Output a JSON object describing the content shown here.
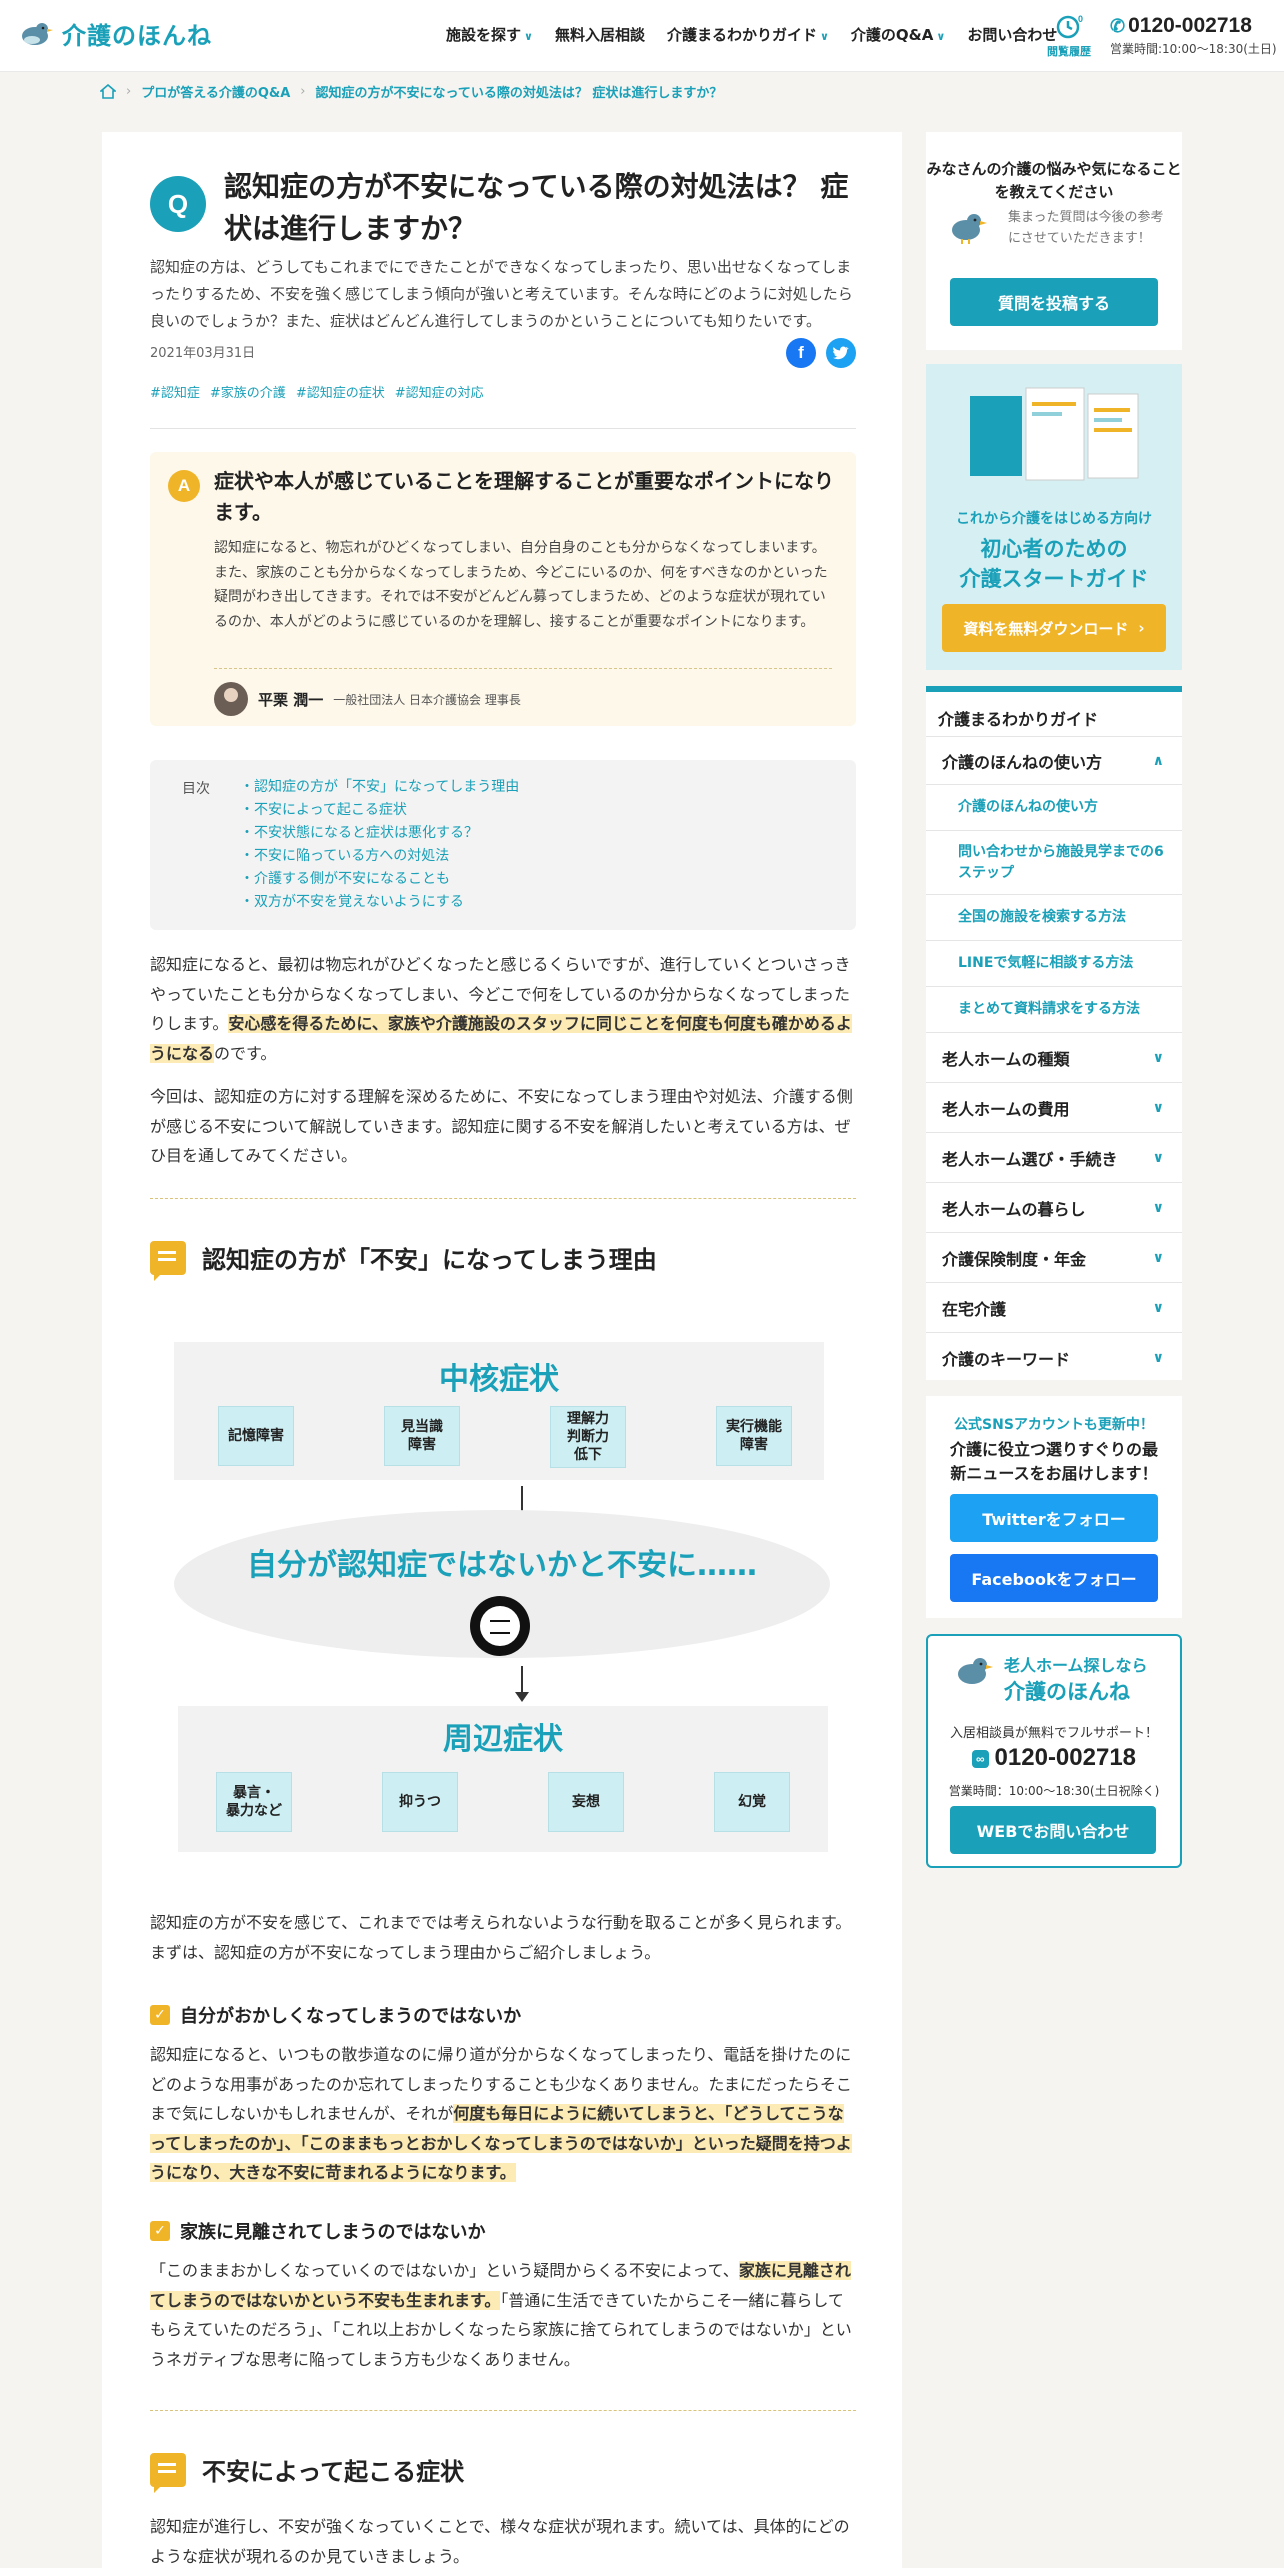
{
  "header": {
    "logo_text": "介護のほんね",
    "nav": [
      {
        "label": "施設を探す",
        "dropdown": true
      },
      {
        "label": "無料入居相談",
        "dropdown": false
      },
      {
        "label": "介護まるわかりガイド",
        "dropdown": true
      },
      {
        "label": "介護のQ&A",
        "dropdown": true
      },
      {
        "label": "お問い合わせ",
        "dropdown": false
      }
    ],
    "history_label": "閲覧履歴",
    "history_count": "0",
    "phone": "0120-002718",
    "hours": "営業時間:10:00〜18:30(土日)"
  },
  "breadcrumb": [
    "プロが答える介護のQ&A",
    "認知症の方が不安になっている際の対処法は？ 症状は進行しますか？"
  ],
  "article": {
    "q_label": "Q",
    "title": "認知症の方が不安になっている際の対処法は？ 症状は進行しますか？",
    "lead": "認知症の方は、どうしてもこれまでにできたことができなくなってしまったり、思い出せなくなってしまったりするため、不安を強く感じてしまう傾向が強いと考えています。そんな時にどのように対処したら良いのでしょうか？また、症状はどんどん進行してしまうのかということについても知りたいです。",
    "date": "2021年03月31日",
    "tags": [
      "#認知症",
      "#家族の介護",
      "#認知症の症状",
      "#認知症の対応"
    ],
    "answer": {
      "a_label": "A",
      "title": "症状や本人が感じていることを理解することが重要なポイントになります。",
      "body": "認知症になると、物忘れがひどくなってしまい、自分自身のことも分からなくなってしまいます。また、家族のことも分からなくなってしまうため、今どこにいるのか、何をすべきなのかといった疑問がわき出してきます。それでは不安がどんどん募ってしまうため、どのような症状が現れているのか、本人がどのように感じているのかを理解し、接することが重要なポイントになります。",
      "author_name": "平栗 潤一",
      "author_org": "一般社団法人 日本介護協会 理事長"
    },
    "toc": {
      "label": "目次",
      "items": [
        "認知症の方が「不安」になってしまう理由",
        "不安によって起こる症状",
        "不安状態になると症状は悪化する？",
        "不安に陥っている方への対処法",
        "介護する側が不安になることも",
        "双方が不安を覚えないようにする"
      ]
    },
    "intro1_a": "認知症になると、最初は物忘れがひどくなったと感じるくらいですが、進行していくとついさっきやっていたことも分からなくなってしまい、今どこで何をしているのか分からなくなってしまったりします。",
    "intro1_hl": "安心感を得るために、家族や介護施設のスタッフに同じことを何度も何度も確かめるようになる",
    "intro1_b": "のです。",
    "intro2": "今回は、認知症の方に対する理解を深めるために、不安になってしまう理由や対処法、介護する側が感じる不安について解説していきます。認知症に関する不安を解消したいと考えている方は、ぜひ目を通してみてください。",
    "section1_title": "認知症の方が「不安」になってしまう理由",
    "diagram": {
      "core_title": "中核症状",
      "core_items": [
        "記憶障害",
        "見当識\n障害",
        "理解力\n判断力\n低下",
        "実行機能\n障害"
      ],
      "middle": "自分が認知症ではないかと不安に……",
      "peripheral_title": "周辺症状",
      "peripheral_items": [
        "暴言・\n暴力など",
        "抑うつ",
        "妄想",
        "幻覚"
      ]
    },
    "section1_p": "認知症の方が不安を感じて、これまででは考えられないような行動を取ることが多く見られます。まずは、認知症の方が不安になってしまう理由からご紹介しましょう。",
    "sub1_title": "自分がおかしくなってしまうのではないか",
    "sub1_a": "認知症になると、いつもの散歩道なのに帰り道が分からなくなってしまったり、電話を掛けたのにどのような用事があったのか忘れてしまったりすることも少なくありません。たまにだったらそこまで気にしないかもしれませんが、それが",
    "sub1_hl": "何度も毎日にように続いてしまうと、「どうしてこうなってしまったのか」、「このままもっとおかしくなってしまうのではないか」といった疑問を持つようになり、大きな不安に苛まれるようになります。",
    "sub2_title": "家族に見離されてしまうのではないか",
    "sub2_a": "「このままおかしくなっていくのではないか」という疑問からくる不安によって、",
    "sub2_hl": "家族に見離されてしまうのではないかという不安も生まれます。",
    "sub2_b": "「普通に生活できていたからこそ一緒に暮らしてもらえていたのだろう」、「これ以上おかしくなったら家族に捨てられてしまうのではないか」というネガティブな思考に陥ってしまう方も少なくありません。",
    "section2_title": "不安によって起こる症状",
    "section2_p": "認知症が進行し、不安が強くなっていくことで、様々な症状が現れます。続いては、具体的にどのような症状が現れるのか見ていきましょう。"
  },
  "sidebar": {
    "question_card": {
      "title": "みなさんの介護の悩みや気になることを教えてください",
      "text": "集まった質問は今後の参考にさせていただきます！",
      "button": "質問を投稿する"
    },
    "guide_banner": {
      "sub": "これから介護をはじめる方向け",
      "title": "初心者のための\n介護スタートガイド",
      "button": "資料を無料ダウンロード"
    },
    "guide_menu": {
      "title": "介護まるわかりガイド",
      "open_section": "介護のほんねの使い方",
      "sub_items": [
        "介護のほんねの使い方",
        "問い合わせから施設見学までの6ステップ",
        "全国の施設を検索する方法",
        "LINEで気軽に相談する方法",
        "まとめて資料請求をする方法"
      ],
      "sections": [
        "老人ホームの種類",
        "老人ホームの費用",
        "老人ホーム選び・手続き",
        "老人ホームの暮らし",
        "介護保険制度・年金",
        "在宅介護",
        "介護のキーワード"
      ]
    },
    "sns_card": {
      "small": "公式SNSアカウントも更新中！",
      "big": "介護に役立つ選りすぐりの最新ニュースをお届けします！",
      "twitter": "Twitterをフォロー",
      "facebook": "Facebookをフォロー"
    },
    "contact_card": {
      "line1": "老人ホーム探しなら",
      "line2": "介護のほんね",
      "text": "入居相談員が無料でフルサポート！",
      "free_label": "通話料無料",
      "phone": "0120-002718",
      "hours": "営業時間：10:00〜18:30(土日祝除く)",
      "button": "WEBでお問い合わせ"
    }
  },
  "colors": {
    "accent": "#1aa0b8",
    "highlight": "#fdebb5",
    "yellow": "#f0b429"
  }
}
